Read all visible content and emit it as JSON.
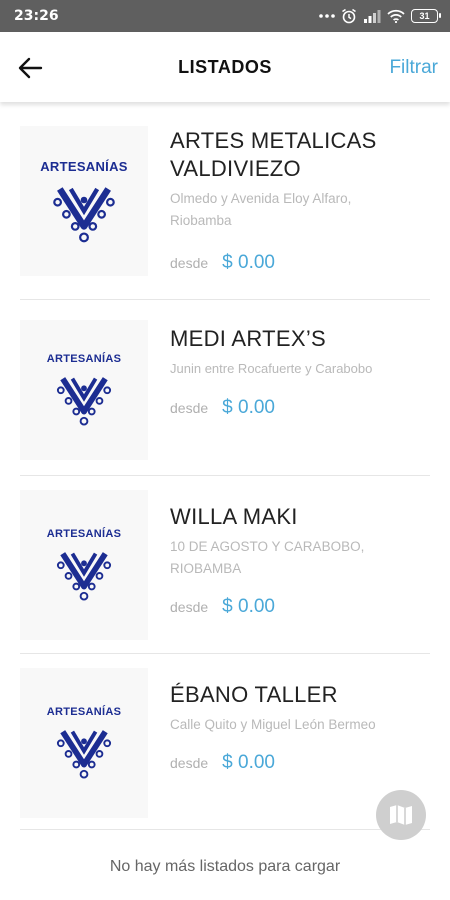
{
  "status_bar": {
    "time": "23:26",
    "battery": "31"
  },
  "header": {
    "title": "LISTADOS",
    "filter_label": "Filtrar"
  },
  "listings": [
    {
      "name_line1": "ARTES METALICAS",
      "name_line2": "VALDIVIEZO",
      "address_line1": "Olmedo y Avenida Eloy Alfaro,",
      "address_line2": "Riobamba",
      "from_label": "desde",
      "price": "$ 0.00",
      "logo_text": "ARTESANÍAS"
    },
    {
      "name_line1": "MEDI ARTEX’S",
      "address_line1": "Junin entre Rocafuerte y Carabobo",
      "from_label": "desde",
      "price": "$ 0.00",
      "logo_text": "ARTESANÍAS"
    },
    {
      "name_line1": "WILLA MAKI",
      "address_line1": "10 DE AGOSTO Y CARABOBO,",
      "address_line2": "RIOBAMBA",
      "from_label": "desde",
      "price": "$ 0.00",
      "logo_text": "ARTESANÍAS"
    },
    {
      "name_line1": "ÉBANO TALLER",
      "address_line1": "Calle Quito y Miguel León Bermeo",
      "from_label": "desde",
      "price": "$ 0.00",
      "logo_text": "ARTESANÍAS"
    }
  ],
  "footer": {
    "message": "No hay más listados para cargar"
  },
  "colors": {
    "accent": "#4aa8d8",
    "logo_blue": "#1c2d92",
    "status_bar": "#5f5f5f"
  },
  "icons": {
    "back": "arrow-left-icon",
    "map": "map-icon",
    "logo": "artesanias-logo"
  }
}
